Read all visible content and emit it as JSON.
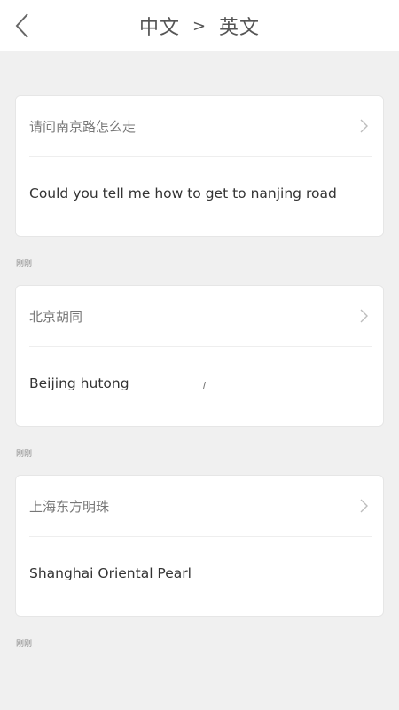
{
  "header": {
    "source_lang": "中文",
    "arrow": ">",
    "target_lang": "英文",
    "back_icon": "chevron-left-icon"
  },
  "history": [
    {
      "source": "请问南京路怎么走",
      "target": "Could you tell me how to get to nanjing road",
      "time": "刚刚"
    },
    {
      "source": "北京胡同",
      "target": "Beijing hutong",
      "time": "刚刚"
    },
    {
      "source": "上海东方明珠",
      "target": "Shanghai Oriental Pearl",
      "time": "刚刚"
    }
  ],
  "colors": {
    "background": "#f0f0f0",
    "card": "#ffffff",
    "text_primary": "#333333",
    "text_secondary": "#777777"
  }
}
